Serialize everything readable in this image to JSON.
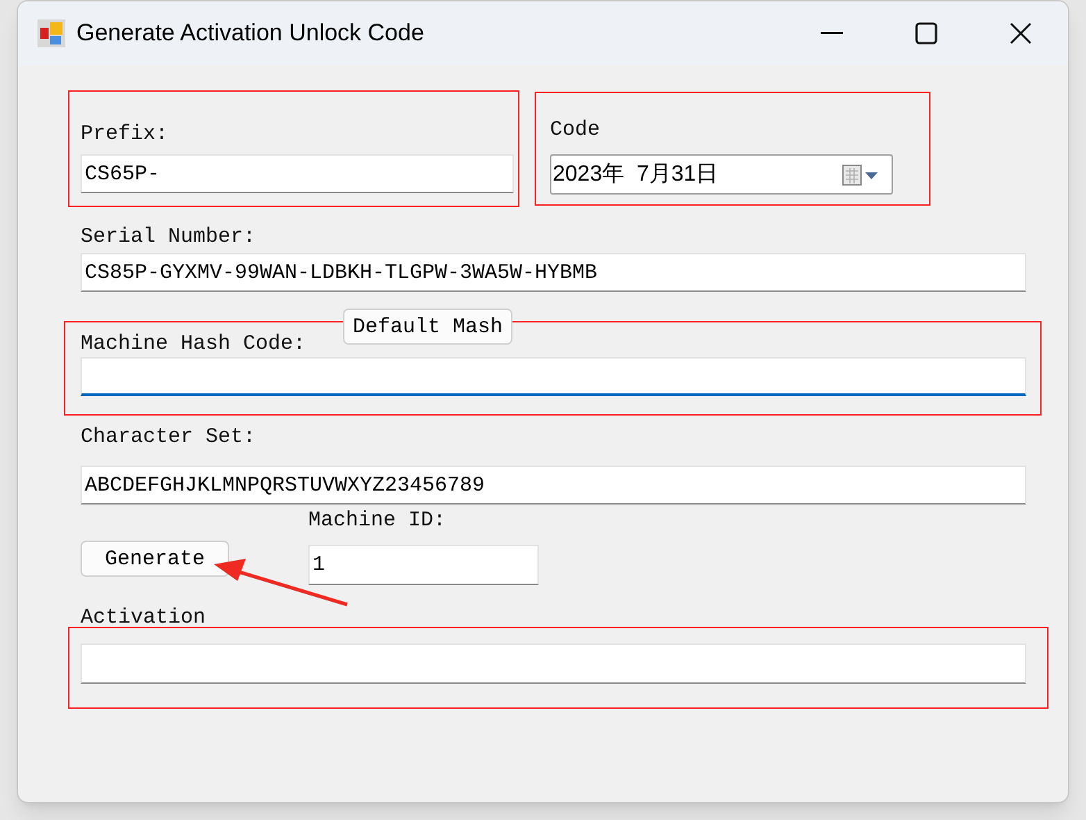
{
  "window": {
    "title": "Generate Activation Unlock Code"
  },
  "prefix": {
    "label": "Prefix:",
    "value": "CS65P-"
  },
  "code": {
    "label": "Code",
    "value": "2023年  7月31日"
  },
  "serial_number": {
    "label": "Serial Number:",
    "value": "CS85P-GYXMV-99WAN-LDBKH-TLGPW-3WA5W-HYBMB"
  },
  "default_mash_button": "Default Mash",
  "machine_hash_code": {
    "label": "Machine Hash Code:",
    "focused": true
  },
  "character_set": {
    "label": "Character Set:",
    "value": "ABCDEFGHJKLMNPQRSTUVWXYZ23456789"
  },
  "generate_button": "Generate",
  "machine_id": {
    "label": "Machine ID:",
    "value": "1"
  },
  "activation": {
    "label": "Activation"
  }
}
